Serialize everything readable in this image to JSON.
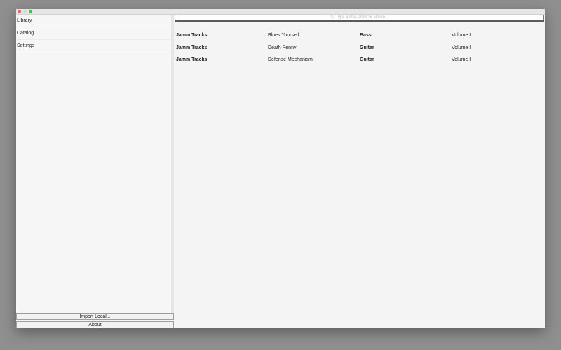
{
  "sidebar": {
    "items": [
      {
        "label": "Library"
      },
      {
        "label": "Catalog"
      },
      {
        "label": "Settings"
      }
    ],
    "import_label": "Import Local...",
    "about_label": "About"
  },
  "search": {
    "placeholder": "Type a title, artist or album...",
    "icon": "search-icon"
  },
  "tracks": [
    {
      "source": "Jamm Tracks",
      "title": "Blues Yourself",
      "instrument": "Bass",
      "volume": "Volume I"
    },
    {
      "source": "Jamm Tracks",
      "title": "Death Penny",
      "instrument": "Guitar",
      "volume": "Volume I"
    },
    {
      "source": "Jamm Tracks",
      "title": "Defense Mechanism",
      "instrument": "Guitar",
      "volume": "Volume I"
    }
  ],
  "colors": {
    "close": "#fc5f57",
    "zoom": "#34c84a"
  }
}
